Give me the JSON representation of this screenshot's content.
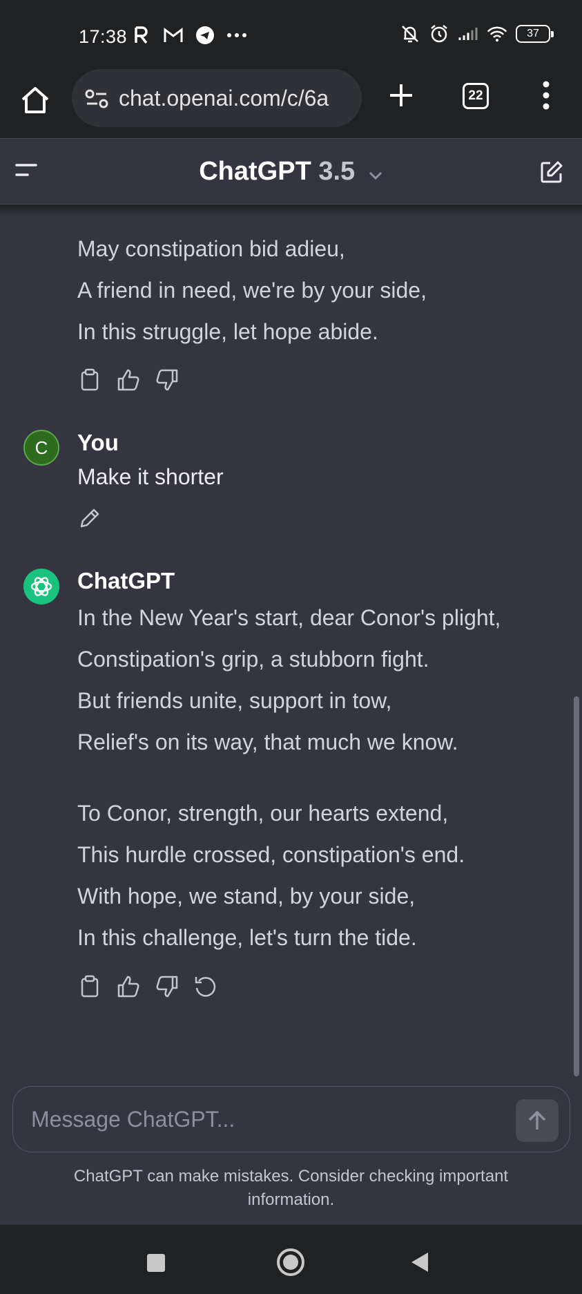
{
  "status_bar": {
    "time": "17:38",
    "battery": "37",
    "left_icons": [
      "r-app-icon",
      "gmail-icon",
      "telegram-icon",
      "more-dots-icon"
    ],
    "right_icons": [
      "bell-off-icon",
      "alarm-icon",
      "signal-icon",
      "wifi-icon",
      "battery-icon"
    ]
  },
  "browser": {
    "url": "chat.openai.com/c/6a",
    "tab_count": "22"
  },
  "header": {
    "title": "ChatGPT",
    "version": "3.5"
  },
  "conversation": {
    "prev_poem_lines": [
      "May constipation bid adieu,",
      "A friend in need, we're by your side,",
      "In this struggle, let hope abide."
    ],
    "user_name": "You",
    "user_initial": "C",
    "user_message": "Make it shorter",
    "assistant_name": "ChatGPT",
    "poem_stanza_1": [
      "In the New Year's start, dear Conor's plight,",
      "Constipation's grip, a stubborn fight.",
      "But friends unite, support in tow,",
      "Relief's on its way, that much we know."
    ],
    "poem_stanza_2": [
      "To Conor, strength, our hearts extend,",
      "This hurdle crossed, constipation's end.",
      "With hope, we stand, by your side,",
      "In this challenge, let's turn the tide."
    ]
  },
  "composer": {
    "placeholder": "Message ChatGPT..."
  },
  "disclaimer": "ChatGPT can make mistakes. Consider checking important information.",
  "colors": {
    "background": "#343541",
    "chrome": "#202123",
    "gpt_green": "#19c37d",
    "user_avatar": "#2f6b1e"
  }
}
